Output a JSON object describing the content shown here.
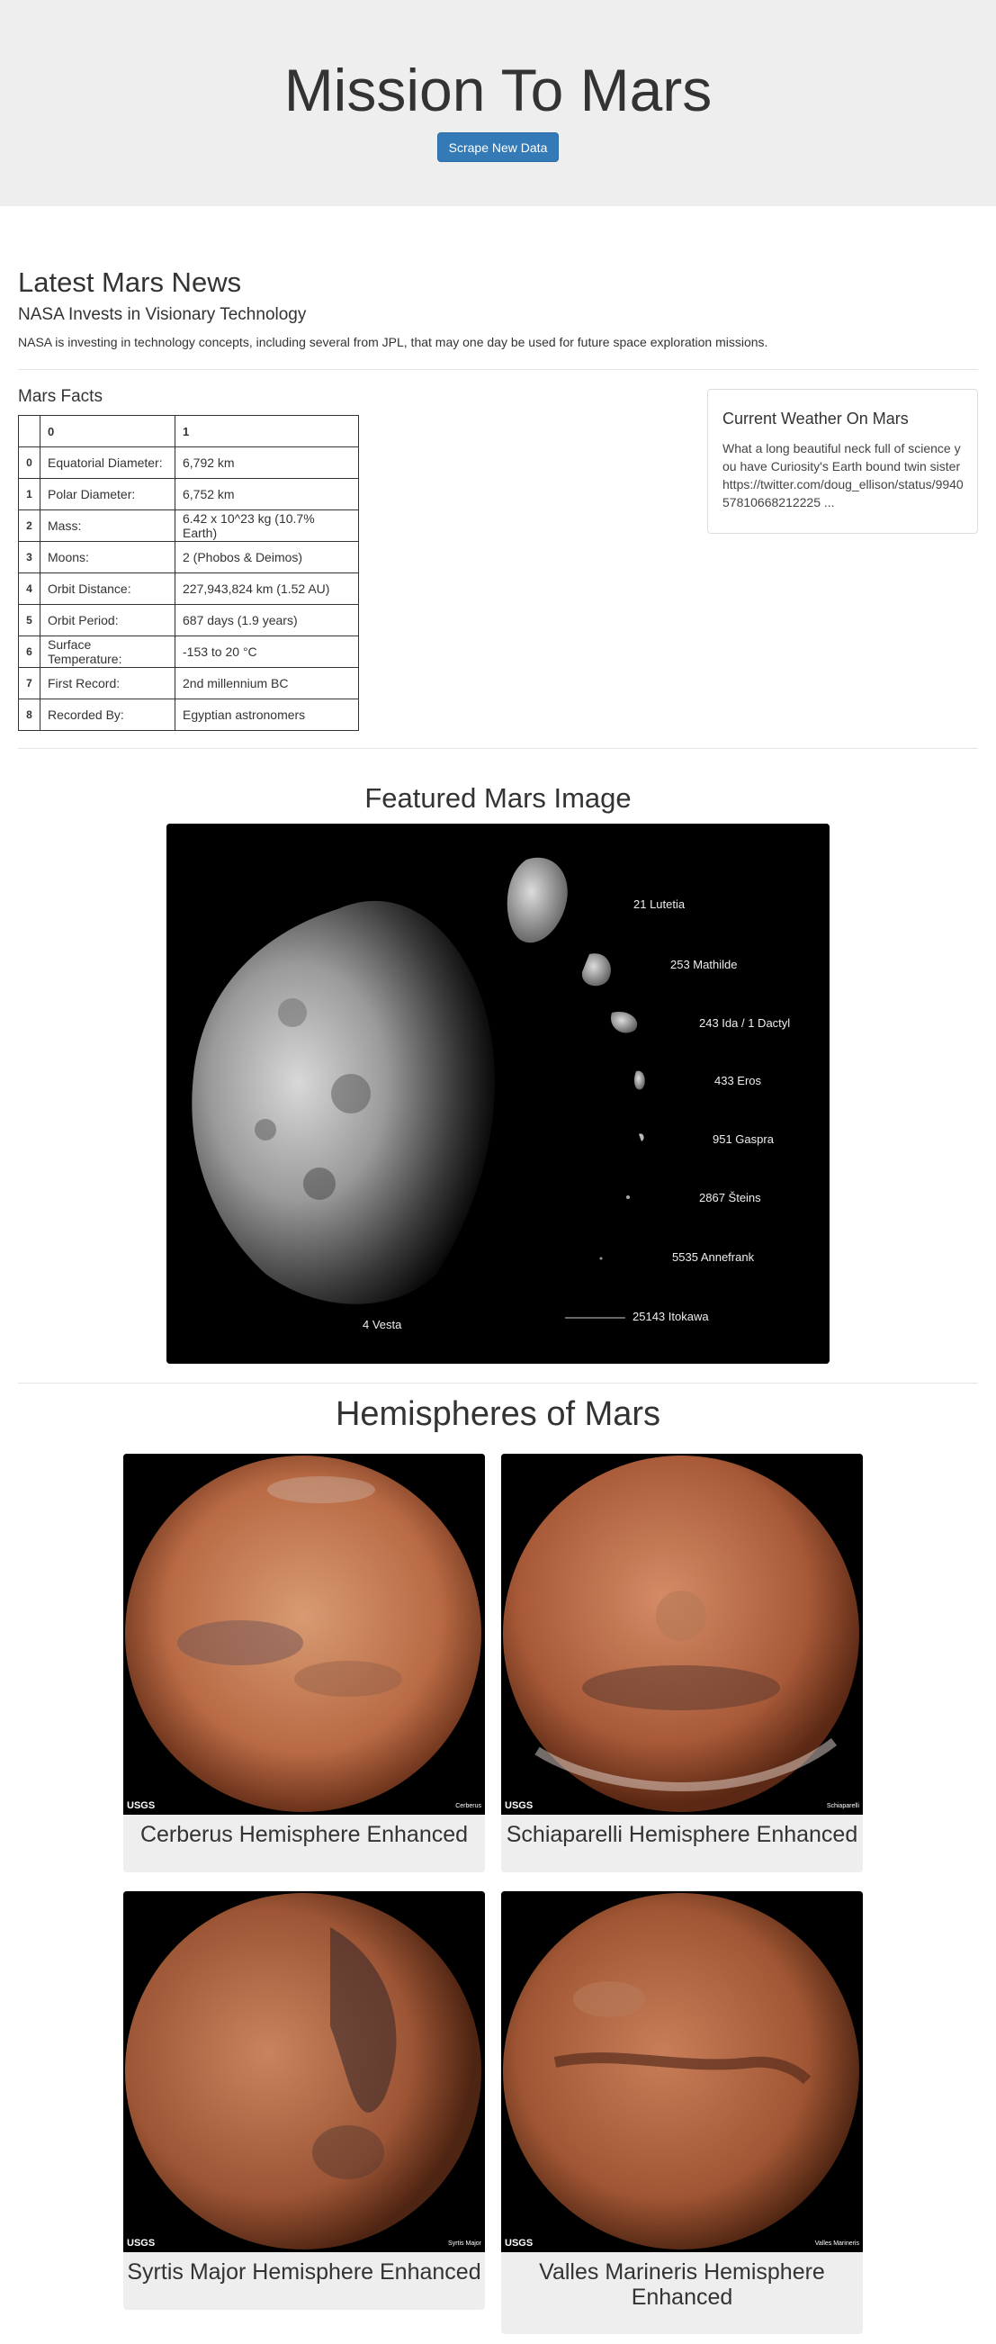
{
  "header": {
    "title": "Mission To Mars",
    "scrape_button": "Scrape New Data"
  },
  "news": {
    "section_title": "Latest Mars News",
    "headline": "NASA Invests in Visionary Technology",
    "teaser": "NASA is investing in technology concepts, including several from JPL, that may one day be used for future space exploration missions."
  },
  "facts": {
    "title": "Mars Facts",
    "columns": [
      "",
      "0",
      "1"
    ],
    "rows": [
      {
        "idx": "0",
        "label": "Equatorial Diameter:",
        "value": "6,792 km"
      },
      {
        "idx": "1",
        "label": "Polar Diameter:",
        "value": "6,752 km"
      },
      {
        "idx": "2",
        "label": "Mass:",
        "value": "6.42 x 10^23 kg (10.7% Earth)"
      },
      {
        "idx": "3",
        "label": "Moons:",
        "value": "2 (Phobos & Deimos)"
      },
      {
        "idx": "4",
        "label": "Orbit Distance:",
        "value": "227,943,824 km (1.52 AU)"
      },
      {
        "idx": "5",
        "label": "Orbit Period:",
        "value": "687 days (1.9 years)"
      },
      {
        "idx": "6",
        "label": "Surface Temperature:",
        "value": "-153 to 20 °C"
      },
      {
        "idx": "7",
        "label": "First Record:",
        "value": "2nd millennium BC"
      },
      {
        "idx": "8",
        "label": "Recorded By:",
        "value": "Egyptian astronomers"
      }
    ]
  },
  "weather": {
    "title": "Current Weather On Mars",
    "text": "What a long beautiful neck full of science you have Curiosity's Earth bound twin sisterhttps://twitter.com/doug_ellison/status/994057810668212225 ..."
  },
  "featured": {
    "title": "Featured Mars Image",
    "labels": [
      "21 Lutetia",
      "253 Mathilde",
      "243 Ida / 1 Dactyl",
      "433 Eros",
      "951 Gaspra",
      "2867 Šteins",
      "5535 Annefrank",
      "25143 Itokawa",
      "4 Vesta"
    ]
  },
  "hemispheres": {
    "title": "Hemispheres of Mars",
    "items": [
      {
        "title": "Cerberus Hemisphere Enhanced",
        "tag": "Cerberus"
      },
      {
        "title": "Schiaparelli Hemisphere Enhanced",
        "tag": "Schiaparelli"
      },
      {
        "title": "Syrtis Major Hemisphere Enhanced",
        "tag": "Syrtis Major"
      },
      {
        "title": "Valles Marineris Hemisphere Enhanced",
        "tag": "Valles Marineris"
      }
    ],
    "logo_text": "USGS"
  },
  "colors": {
    "primary_button": "#337ab7",
    "jumbotron_bg": "#eeeeee",
    "mars_surface": "#c0704c"
  }
}
